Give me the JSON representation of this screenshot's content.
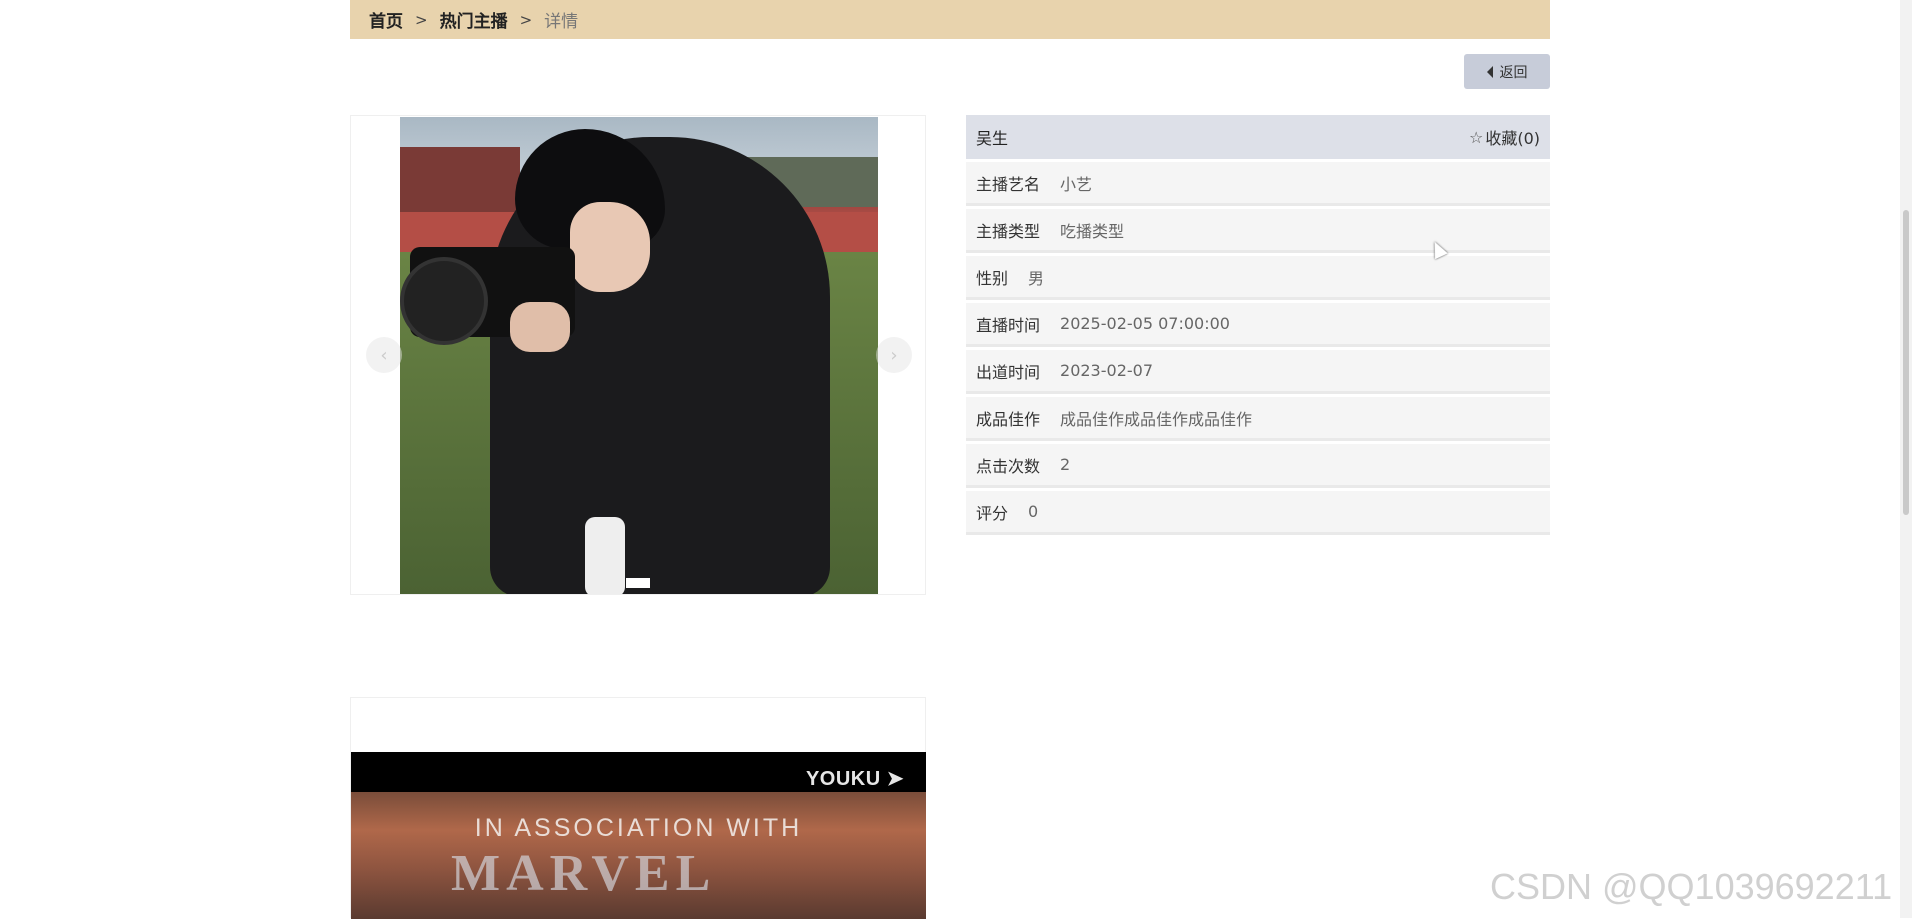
{
  "breadcrumb": {
    "home": "首页",
    "sep1": ">",
    "section": "热门主播",
    "sep2": ">",
    "current": "详情"
  },
  "back_button": {
    "label": "返回"
  },
  "carousel": {
    "prev": "‹",
    "next": "›"
  },
  "detail": {
    "name": "吴生",
    "favorite_label": "收藏(0)",
    "rows": [
      {
        "key": "主播艺名",
        "value": "小艺"
      },
      {
        "key": "主播类型",
        "value": "吃播类型"
      },
      {
        "key": "性别",
        "value": "男"
      },
      {
        "key": "直播时间",
        "value": "2025-02-05 07:00:00"
      },
      {
        "key": "出道时间",
        "value": "2023-02-07"
      },
      {
        "key": "成品佳作",
        "value": "成品佳作成品佳作成品佳作"
      },
      {
        "key": "点击次数",
        "value": "2"
      },
      {
        "key": "评分",
        "value": "0"
      }
    ]
  },
  "video": {
    "brand": "YOUKU ➤",
    "caption": "IN ASSOCIATION WITH",
    "logo_text": "MARVEL"
  },
  "watermark": "CSDN @QQ1039692211"
}
